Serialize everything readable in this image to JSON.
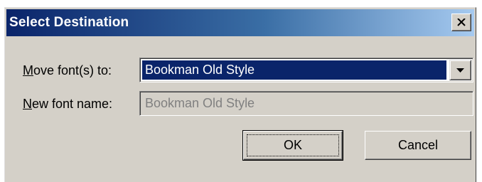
{
  "dialog": {
    "title": "Select Destination",
    "close_icon": "close-icon"
  },
  "form": {
    "move_label_mnemonic": "M",
    "move_label_rest": "ove font(s) to:",
    "move_value": "Bookman Old Style",
    "dropdown_icon": "chevron-down-icon",
    "new_label_mnemonic": "N",
    "new_label_rest": "ew font name:",
    "new_value": "Bookman Old Style"
  },
  "buttons": {
    "ok_label": "OK",
    "cancel_label": "Cancel"
  },
  "colors": {
    "title_gradient_start": "#0a246a",
    "title_gradient_end": "#a6caf0",
    "dialog_face": "#d4d0c8",
    "selection_highlight": "#0a246a",
    "disabled_text": "#808080"
  }
}
